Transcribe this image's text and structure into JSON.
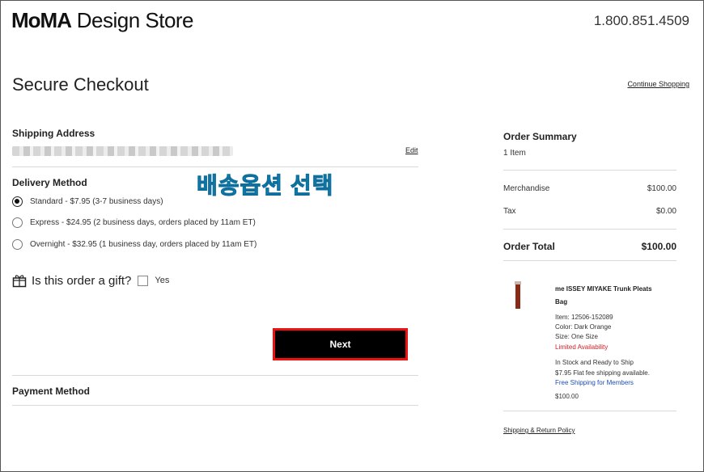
{
  "header": {
    "logo_bold": "MoMA",
    "logo_regular": "Design Store",
    "phone": "1.800.851.4509"
  },
  "page": {
    "title": "Secure Checkout",
    "continue_link": "Continue Shopping"
  },
  "shipping": {
    "label": "Shipping Address",
    "edit_link": "Edit"
  },
  "delivery": {
    "label": "Delivery Method",
    "annotation": "배송옵션 선택",
    "options": [
      {
        "label": "Standard - $7.95 (3-7 business days)",
        "selected": true
      },
      {
        "label": "Express - $24.95 (2 business days, orders placed by 11am ET)",
        "selected": false
      },
      {
        "label": "Overnight - $32.95 (1 business day, orders placed by 11am ET)",
        "selected": false
      }
    ]
  },
  "gift": {
    "question": "Is this order a gift?",
    "checkbox_label": "Yes"
  },
  "next_button": "Next",
  "payment": {
    "label": "Payment Method"
  },
  "summary": {
    "title": "Order Summary",
    "item_count": "1 Item",
    "merchandise_label": "Merchandise",
    "merchandise_value": "$100.00",
    "tax_label": "Tax",
    "tax_value": "$0.00",
    "total_label": "Order Total",
    "total_value": "$100.00"
  },
  "product": {
    "name": "me ISSEY MIYAKE Trunk Pleats Bag",
    "item": "Item: 12506-152089",
    "color": "Color: Dark Orange",
    "size": "Size: One Size",
    "availability": "Limited Availability",
    "stock": "In Stock and Ready to Ship",
    "shipping_fee": "$7.95 Flat fee shipping available.",
    "member_shipping": "Free Shipping for Members",
    "price": "$100.00",
    "image_color": "#8a2a14"
  },
  "policy_link": "Shipping & Return Policy",
  "colors": {
    "annotation_text": "#1a9fd6",
    "highlight_border": "#e11111",
    "availability": "#d0202a",
    "member_link": "#1e4fb0"
  }
}
